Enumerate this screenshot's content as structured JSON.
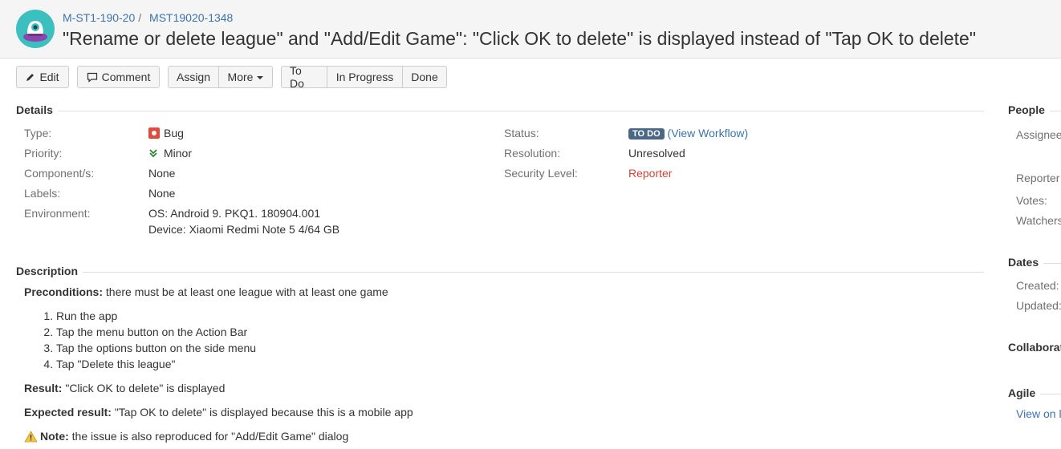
{
  "header": {
    "project_key": "M-ST1-190-20",
    "separator": "/",
    "issue_key": "MST19020-1348",
    "summary": "\"Rename or delete league\" and \"Add/Edit Game\": \"Click OK to delete\" is displayed instead of \"Tap OK to delete\""
  },
  "toolbar": {
    "edit": "Edit",
    "comment": "Comment",
    "assign": "Assign",
    "more": "More",
    "todo": "To Do",
    "in_progress": "In Progress",
    "done": "Done"
  },
  "details": {
    "title": "Details",
    "left": [
      {
        "label": "Type:",
        "value": "Bug"
      },
      {
        "label": "Priority:",
        "value": "Minor"
      },
      {
        "label": "Component/s:",
        "value": "None"
      },
      {
        "label": "Labels:",
        "value": "None"
      },
      {
        "label": "Environment:",
        "value": "OS: Android 9. PKQ1. 180904.001",
        "value2": "Device: Xiaomi Redmi Note 5 4/64 GB"
      }
    ],
    "right": [
      {
        "label": "Status:",
        "value": "TO DO",
        "link": "(View Workflow)"
      },
      {
        "label": "Resolution:",
        "value": "Unresolved"
      },
      {
        "label": "Security Level:",
        "value": "Reporter"
      }
    ]
  },
  "description": {
    "title": "Description",
    "pre_label": "Preconditions:",
    "pre_text": " there must be at least one league with at least one game",
    "steps": [
      "Run the app",
      "Tap the menu button on the Action Bar",
      "Tap the options button on the side menu",
      "Tap \"Delete this league\""
    ],
    "result_label": "Result:",
    "result_text": " \"Click OK to delete\" is displayed",
    "expected_label": "Expected result:",
    "expected_text": " \"Tap OK to delete\" is displayed because this is a mobile app",
    "note_label": "Note:",
    "note_text": " the issue is also reproduced for \"Add/Edit Game\" dialog"
  },
  "sidebar": {
    "people_title": "People",
    "assignee": "Assignee",
    "reporter": "Reporter",
    "votes": "Votes:",
    "watchers": "Watchers",
    "dates_title": "Dates",
    "created": "Created:",
    "updated": "Updated:",
    "collaborators_title": "Collaborat",
    "agile_title": "Agile",
    "agile_link": "View on l"
  },
  "colors": {
    "link": "#3b73af",
    "status_lozenge": "#4a6785",
    "security_level": "#d04437",
    "bug_icon": "#e5493a",
    "priority_icon": "#2a8735",
    "avatar": "#3bbfbf"
  }
}
